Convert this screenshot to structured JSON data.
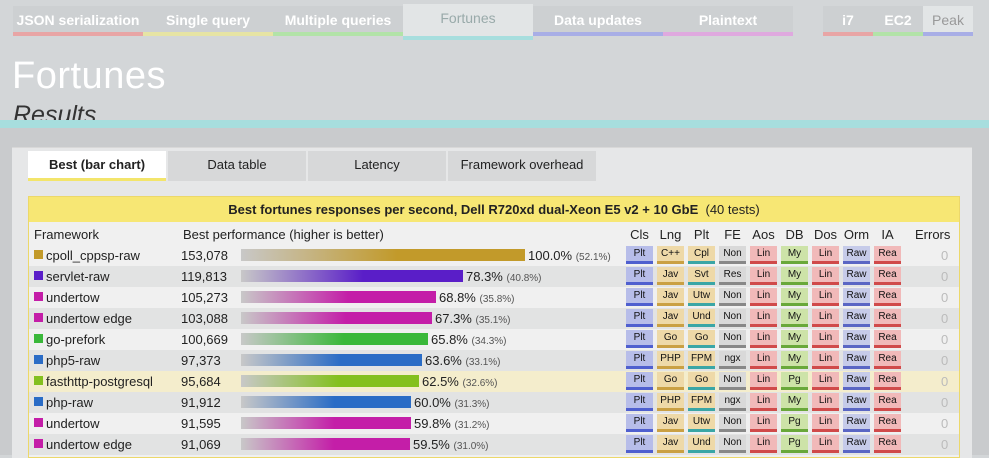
{
  "top_tabs": [
    {
      "label": "JSON serialization",
      "color": "#e8a5a5"
    },
    {
      "label": "Single query",
      "color": "#e6e4a4"
    },
    {
      "label": "Multiple queries",
      "color": "#b2e3a8"
    },
    {
      "label": "Fortunes",
      "color": "#a7dede",
      "active": true
    },
    {
      "label": "Data updates",
      "color": "#a8aee6"
    },
    {
      "label": "Plaintext",
      "color": "#dfa9df"
    },
    {
      "label": "i7",
      "color": "#e8a5a5"
    },
    {
      "label": "EC2",
      "color": "#b2e3a8"
    },
    {
      "label": "Peak",
      "color": "#a8aee6"
    }
  ],
  "header": {
    "title": "Fortunes",
    "subtitle": "Results"
  },
  "sub_tabs": [
    {
      "label": "Best (bar chart)",
      "active": true
    },
    {
      "label": "Data table"
    },
    {
      "label": "Latency"
    },
    {
      "label": "Framework overhead"
    }
  ],
  "table": {
    "caption_bold": "Best fortunes responses per second, Dell R720xd dual-Xeon E5 v2 + 10 GbE",
    "caption_extra": "(40 tests)",
    "col_framework": "Framework",
    "col_perf": "Best performance (higher is better)",
    "attr_headers": [
      "Cls",
      "Lng",
      "Plt",
      "FE",
      "Aos",
      "DB",
      "Dos",
      "Orm",
      "IA"
    ],
    "col_errors": "Errors",
    "rows": [
      {
        "framework": "cpoll_cppsp-raw",
        "value": "153,078",
        "pct": "100.0%",
        "pct_rel": "(52.1%)",
        "fraction": 1.0,
        "color": "#c29a2a",
        "attrs": [
          "Plt",
          "C++",
          "Cpl",
          "Non",
          "Lin",
          "My",
          "Lin",
          "Raw",
          "Rea"
        ],
        "errors": "0"
      },
      {
        "framework": "servlet-raw",
        "value": "119,813",
        "pct": "78.3%",
        "pct_rel": "(40.8%)",
        "fraction": 0.783,
        "color": "#5a1ec8",
        "attrs": [
          "Plt",
          "Jav",
          "Svt",
          "Res",
          "Lin",
          "My",
          "Lin",
          "Raw",
          "Rea"
        ],
        "errors": "0"
      },
      {
        "framework": "undertow",
        "value": "105,273",
        "pct": "68.8%",
        "pct_rel": "(35.8%)",
        "fraction": 0.688,
        "color": "#c41ea8",
        "attrs": [
          "Plt",
          "Jav",
          "Utw",
          "Non",
          "Lin",
          "My",
          "Lin",
          "Raw",
          "Rea"
        ],
        "errors": "0"
      },
      {
        "framework": "undertow edge",
        "value": "103,088",
        "pct": "67.3%",
        "pct_rel": "(35.1%)",
        "fraction": 0.673,
        "color": "#c41ea8",
        "attrs": [
          "Plt",
          "Jav",
          "Und",
          "Non",
          "Lin",
          "My",
          "Lin",
          "Raw",
          "Rea"
        ],
        "errors": "0"
      },
      {
        "framework": "go-prefork",
        "value": "100,669",
        "pct": "65.8%",
        "pct_rel": "(34.3%)",
        "fraction": 0.658,
        "color": "#3ab83a",
        "attrs": [
          "Plt",
          "Go",
          "Go",
          "Non",
          "Lin",
          "My",
          "Lin",
          "Raw",
          "Rea"
        ],
        "errors": "0"
      },
      {
        "framework": "php5-raw",
        "value": "97,373",
        "pct": "63.6%",
        "pct_rel": "(33.1%)",
        "fraction": 0.636,
        "color": "#2a6cc6",
        "attrs": [
          "Plt",
          "PHP",
          "FPM",
          "ngx",
          "Lin",
          "My",
          "Lin",
          "Raw",
          "Rea"
        ],
        "errors": "0"
      },
      {
        "framework": "fasthttp-postgresql",
        "value": "95,684",
        "pct": "62.5%",
        "pct_rel": "(32.6%)",
        "fraction": 0.625,
        "color": "#84c01e",
        "attrs": [
          "Plt",
          "Go",
          "Go",
          "Non",
          "Lin",
          "Pg",
          "Lin",
          "Raw",
          "Rea"
        ],
        "errors": "0",
        "highlight": true
      },
      {
        "framework": "php-raw",
        "value": "91,912",
        "pct": "60.0%",
        "pct_rel": "(31.3%)",
        "fraction": 0.6,
        "color": "#2a6cc6",
        "attrs": [
          "Plt",
          "PHP",
          "FPM",
          "ngx",
          "Lin",
          "My",
          "Lin",
          "Raw",
          "Rea"
        ],
        "errors": "0"
      },
      {
        "framework": "undertow",
        "value": "91,595",
        "pct": "59.8%",
        "pct_rel": "(31.2%)",
        "fraction": 0.598,
        "color": "#c41ea8",
        "attrs": [
          "Plt",
          "Jav",
          "Utw",
          "Non",
          "Lin",
          "Pg",
          "Lin",
          "Raw",
          "Rea"
        ],
        "errors": "0"
      },
      {
        "framework": "undertow edge",
        "value": "91,069",
        "pct": "59.5%",
        "pct_rel": "(31.0%)",
        "fraction": 0.595,
        "color": "#c41ea8",
        "attrs": [
          "Plt",
          "Jav",
          "Und",
          "Non",
          "Lin",
          "Pg",
          "Lin",
          "Raw",
          "Rea"
        ],
        "errors": "0"
      }
    ]
  }
}
